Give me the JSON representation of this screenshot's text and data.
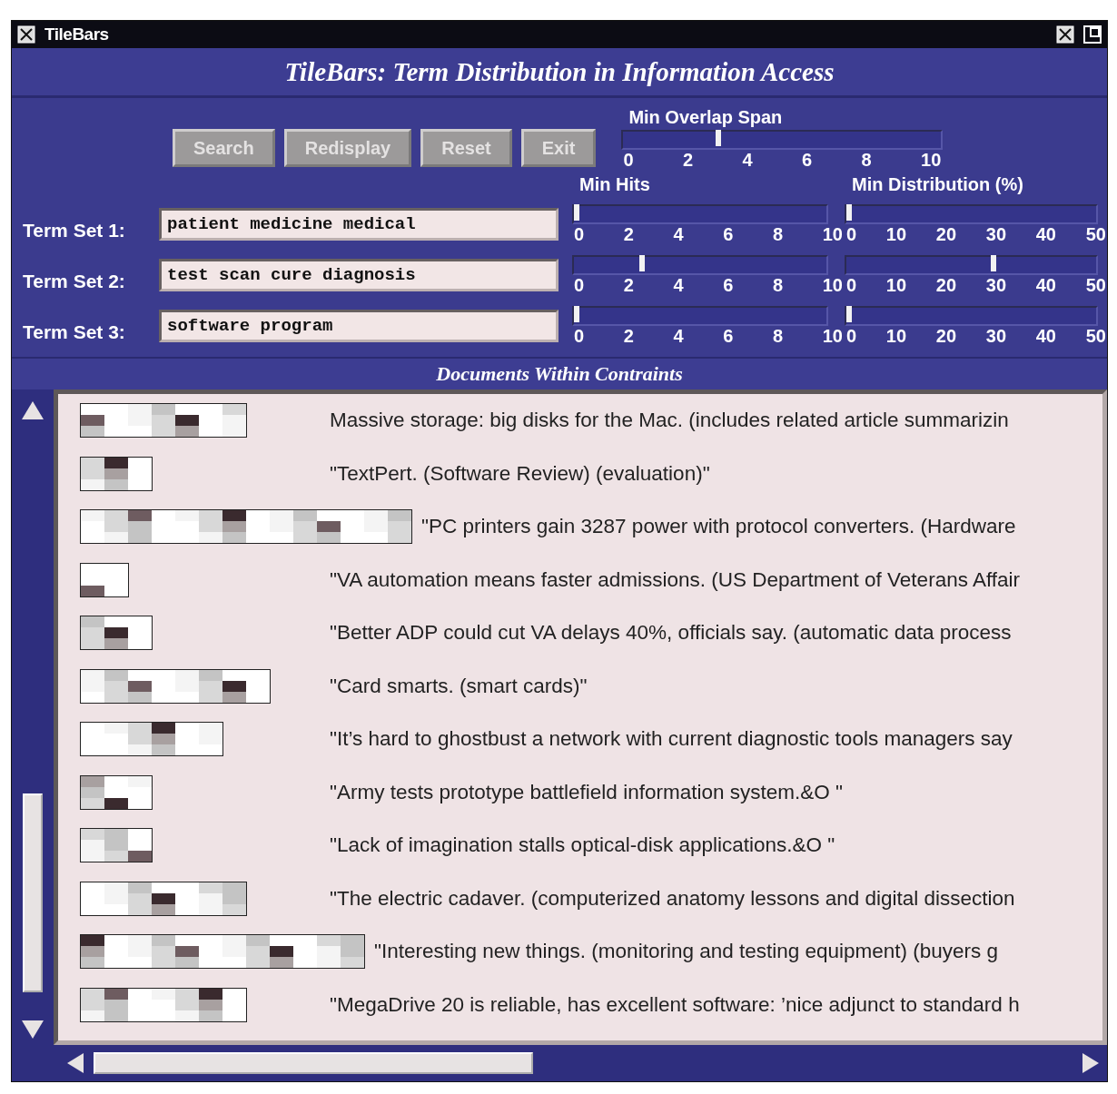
{
  "window": {
    "title": "TileBars"
  },
  "header": "TileBars: Term Distribution in Information Access",
  "buttons": [
    {
      "label": "Search"
    },
    {
      "label": "Redisplay"
    },
    {
      "label": "Reset"
    },
    {
      "label": "Exit"
    }
  ],
  "min_overlap_span": {
    "label": "Min Overlap Span",
    "level": 0.3,
    "ticks": [
      "0",
      "2",
      "4",
      "6",
      "8",
      "10"
    ]
  },
  "columns": {
    "min_hits": "Min Hits",
    "min_distribution": "Min Distribution (%)"
  },
  "term_sets": [
    {
      "label": "Term Set 1:",
      "value": "patient medicine medical",
      "min_hits": {
        "level": 0,
        "ticks": [
          "0",
          "2",
          "4",
          "6",
          "8",
          "10"
        ]
      },
      "min_distribution": {
        "level": 0,
        "ticks": [
          "0",
          "10",
          "20",
          "30",
          "40",
          "50"
        ]
      }
    },
    {
      "label": "Term Set 2:",
      "value": "test scan cure diagnosis",
      "min_hits": {
        "level": 0.27,
        "ticks": [
          "0",
          "2",
          "4",
          "6",
          "8",
          "10"
        ]
      },
      "min_distribution": {
        "level": 0.6,
        "ticks": [
          "0",
          "10",
          "20",
          "30",
          "40",
          "50"
        ]
      }
    },
    {
      "label": "Term Set 3:",
      "value": "software program",
      "min_hits": {
        "level": 0,
        "ticks": [
          "0",
          "2",
          "4",
          "6",
          "8",
          "10"
        ]
      },
      "min_distribution": {
        "level": 0,
        "ticks": [
          "0",
          "10",
          "20",
          "30",
          "40",
          "50"
        ]
      }
    }
  ],
  "documents_title": "Documents Within Contraints",
  "documents": [
    {
      "title": "Massive storage: big disks for the Mac. (includes related article summarizin"
    },
    {
      "title": "\"TextPert. (Software Review) (evaluation)\""
    },
    {
      "title": "\"PC printers gain 3287 power with protocol converters. (Hardware"
    },
    {
      "title": "\"VA automation means faster admissions. (US Department of Veterans Affair"
    },
    {
      "title": "\"Better ADP could cut VA delays 40%, officials say. (automatic data process"
    },
    {
      "title": "\"Card smarts. (smart cards)\""
    },
    {
      "title": "\"It’s hard to ghostbust a network with current diagnostic tools  managers say"
    },
    {
      "title": "\"Army tests prototype battlefield information system.&O \""
    },
    {
      "title": "\"Lack of imagination stalls optical-disk applications.&O \""
    },
    {
      "title": "\"The electric cadaver. (computerized anatomy lessons and digital dissection"
    },
    {
      "title": "\"Interesting new things. (monitoring and testing equipment) (buyers g"
    },
    {
      "title": "\"MegaDrive 20 is reliable, has excellent software: ’nice adjunct to standard h"
    }
  ]
}
